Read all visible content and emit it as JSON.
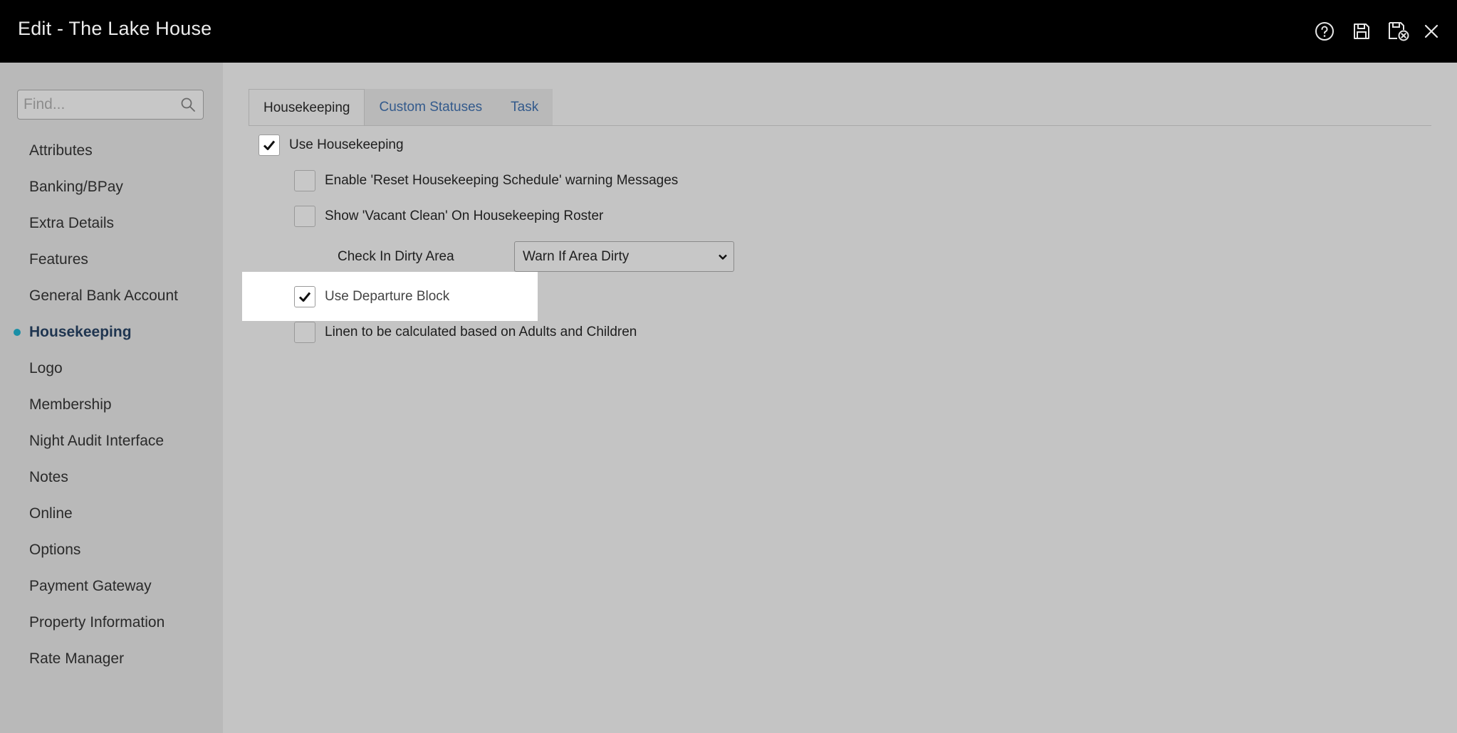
{
  "window": {
    "title": "Edit - The Lake House"
  },
  "toolbar": {
    "icons": [
      "help-icon",
      "save-icon",
      "save-close-icon",
      "close-icon"
    ]
  },
  "sidebar": {
    "search": {
      "placeholder": "Find...",
      "value": ""
    },
    "items": [
      {
        "label": "Attributes",
        "active": false
      },
      {
        "label": "Banking/BPay",
        "active": false
      },
      {
        "label": "Extra Details",
        "active": false
      },
      {
        "label": "Features",
        "active": false
      },
      {
        "label": "General Bank Account",
        "active": false
      },
      {
        "label": "Housekeeping",
        "active": true
      },
      {
        "label": "Logo",
        "active": false
      },
      {
        "label": "Membership",
        "active": false
      },
      {
        "label": "Night Audit Interface",
        "active": false
      },
      {
        "label": "Notes",
        "active": false
      },
      {
        "label": "Online",
        "active": false
      },
      {
        "label": "Options",
        "active": false
      },
      {
        "label": "Payment Gateway",
        "active": false
      },
      {
        "label": "Property Information",
        "active": false
      },
      {
        "label": "Rate Manager",
        "active": false
      }
    ]
  },
  "tabs": [
    {
      "label": "Housekeeping",
      "active": true
    },
    {
      "label": "Custom Statuses",
      "active": false
    },
    {
      "label": "Task",
      "active": false
    }
  ],
  "settings": {
    "use_housekeeping": {
      "label": "Use Housekeeping",
      "checked": true
    },
    "reset_warning": {
      "label": "Enable 'Reset Housekeeping Schedule' warning Messages",
      "checked": false
    },
    "vacant_clean": {
      "label": "Show 'Vacant Clean' On Housekeeping Roster",
      "checked": false
    },
    "check_in_dirty": {
      "label": "Check In Dirty Area",
      "value": "Warn If Area Dirty"
    },
    "departure_block": {
      "label": "Use Departure Block",
      "checked": true
    },
    "linen": {
      "label": "Linen to be calculated based on Adults and Children",
      "checked": false
    }
  },
  "colors": {
    "titlebar": "#000000",
    "active_dot": "#1a8fa6",
    "tab_link": "#335a8c"
  }
}
